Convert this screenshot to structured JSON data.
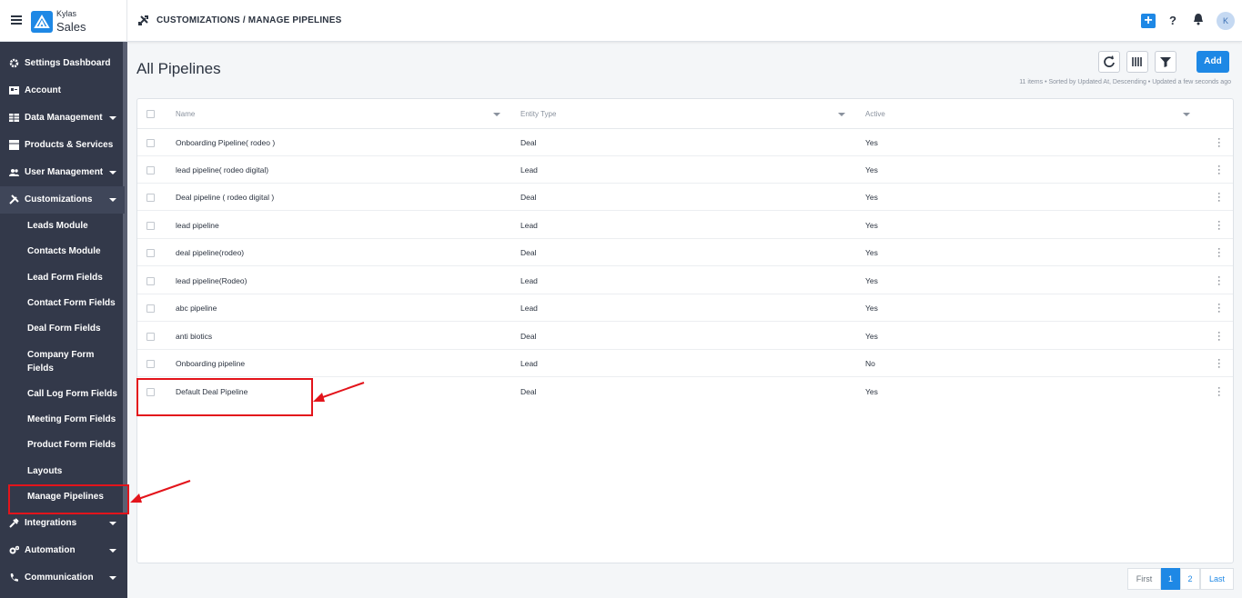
{
  "app": {
    "brand_top": "Kylas",
    "brand_bottom": "Sales",
    "avatar_initial": "K"
  },
  "header": {
    "breadcrumb": "CUSTOMIZATIONS / MANAGE PIPELINES",
    "plus": "+",
    "help": "?"
  },
  "sidebar": {
    "items": [
      {
        "label": "Settings Dashboard",
        "icon": "gear-icon"
      },
      {
        "label": "Account",
        "icon": "account-icon"
      },
      {
        "label": "Data Management",
        "icon": "table-icon",
        "caret": true
      },
      {
        "label": "Products & Services",
        "icon": "box-icon"
      },
      {
        "label": "User Management",
        "icon": "users-icon",
        "caret": true
      },
      {
        "label": "Customizations",
        "icon": "tools-icon",
        "caret": true,
        "expanded": true
      }
    ],
    "sub_items": [
      "Leads Module",
      "Contacts Module",
      "Lead Form Fields",
      "Contact Form Fields",
      "Deal Form Fields",
      "Company Form Fields",
      "Call Log Form Fields",
      "Meeting Form Fields",
      "Product Form Fields",
      "Layouts",
      "Manage Pipelines"
    ],
    "bottom_items": [
      {
        "label": "Integrations",
        "icon": "plug-icon",
        "caret": true
      },
      {
        "label": "Automation",
        "icon": "cogs-icon",
        "caret": true
      },
      {
        "label": "Communication",
        "icon": "phone-icon",
        "caret": true
      }
    ]
  },
  "main": {
    "title": "All Pipelines",
    "add_label": "Add",
    "meta": "11 items • Sorted by Updated At, Descending • Updated a few seconds ago",
    "columns": [
      "Name",
      "Entity Type",
      "Active"
    ],
    "rows": [
      [
        "Onboarding Pipeline( rodeo )",
        "Deal",
        "Yes"
      ],
      [
        "lead pipeline( rodeo digital)",
        "Lead",
        "Yes"
      ],
      [
        "Deal pipeline ( rodeo digital )",
        "Deal",
        "Yes"
      ],
      [
        "lead pipeline",
        "Lead",
        "Yes"
      ],
      [
        "deal pipeline(rodeo)",
        "Deal",
        "Yes"
      ],
      [
        "lead pipeline(Rodeo)",
        "Lead",
        "Yes"
      ],
      [
        "abc pipeline",
        "Lead",
        "Yes"
      ],
      [
        "anti biotics",
        "Deal",
        "Yes"
      ],
      [
        "Onboarding pipeline",
        "Lead",
        "No"
      ],
      [
        "Default Deal Pipeline",
        "Deal",
        "Yes"
      ]
    ]
  },
  "pagination": {
    "first": "First",
    "pages": [
      "1",
      "2"
    ],
    "last": "Last",
    "current": "1"
  },
  "colors": {
    "accent": "#1e88e5",
    "sidebar": "#33394a",
    "highlight": "#e3141b"
  }
}
